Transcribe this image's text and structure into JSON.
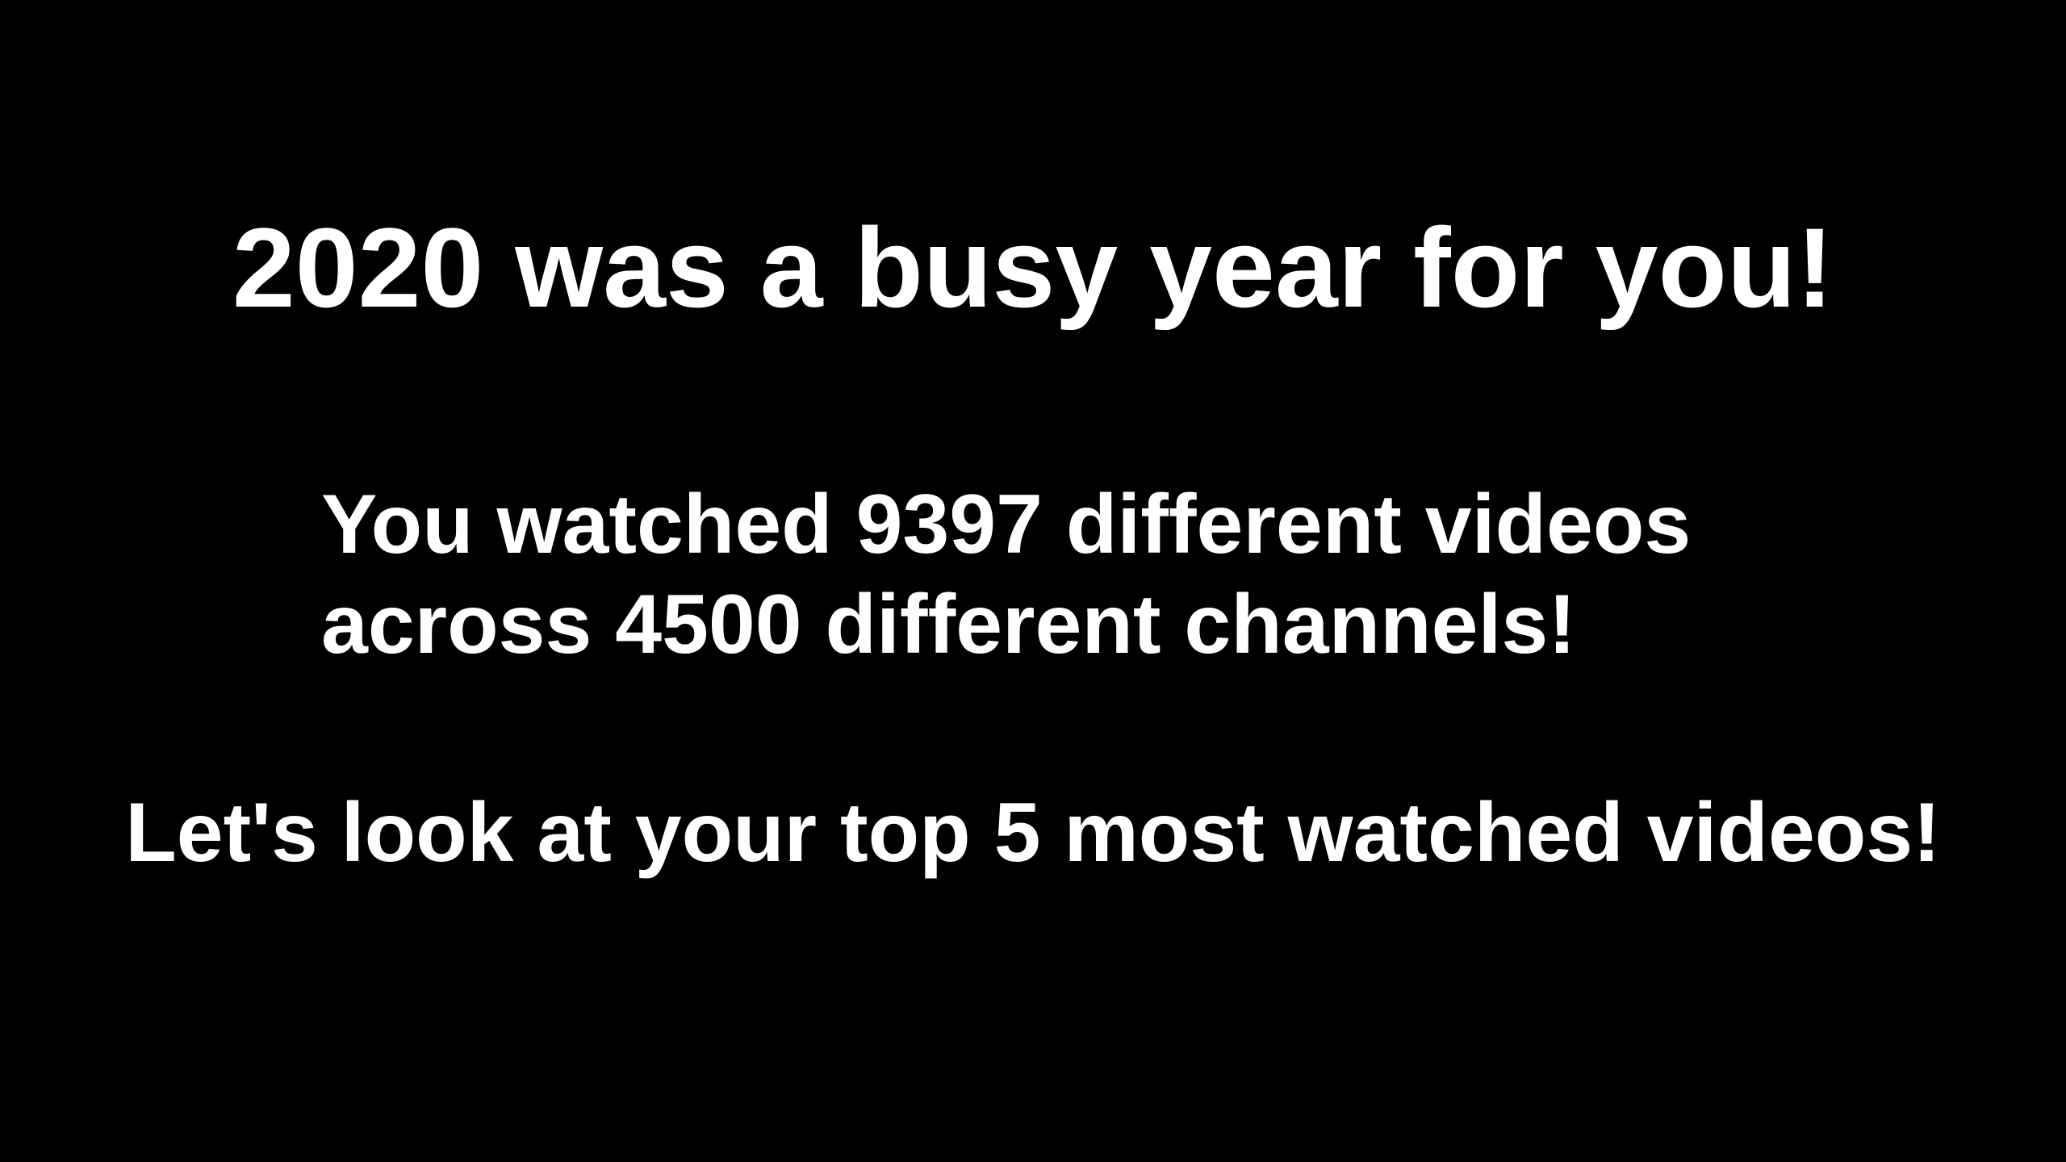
{
  "slide": {
    "headline": "2020 was a busy year for you!",
    "stats_line_1": "You watched 9397 different videos",
    "stats_line_2": "across 4500 different channels!",
    "teaser": "Let's look at your top 5 most watched videos!",
    "background_color": "#000000",
    "text_color": "#ffffff"
  }
}
